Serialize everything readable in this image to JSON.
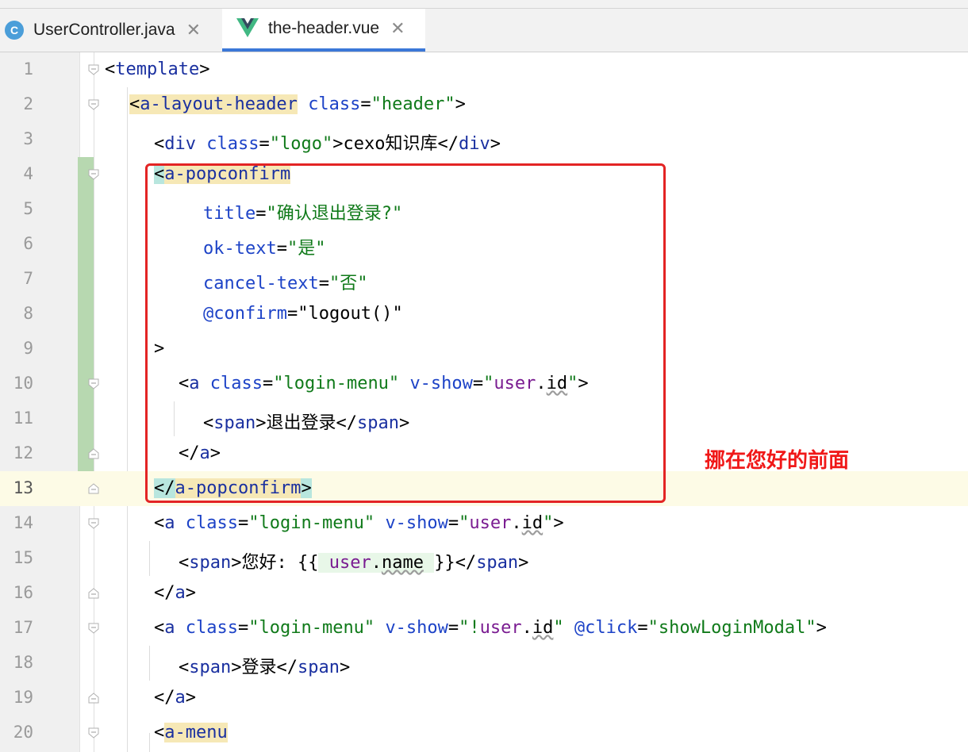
{
  "tabs": [
    {
      "icon": "java-class-icon",
      "icon_letter": "C",
      "label": "UserController.java",
      "active": false
    },
    {
      "icon": "vue-icon",
      "label": "the-header.vue",
      "active": true
    }
  ],
  "lines": [
    {
      "n": "1"
    },
    {
      "n": "2"
    },
    {
      "n": "3"
    },
    {
      "n": "4"
    },
    {
      "n": "5"
    },
    {
      "n": "6"
    },
    {
      "n": "7"
    },
    {
      "n": "8"
    },
    {
      "n": "9"
    },
    {
      "n": "10"
    },
    {
      "n": "11"
    },
    {
      "n": "12"
    },
    {
      "n": "13",
      "current": true
    },
    {
      "n": "14"
    },
    {
      "n": "15"
    },
    {
      "n": "16"
    },
    {
      "n": "17"
    },
    {
      "n": "18"
    },
    {
      "n": "19"
    },
    {
      "n": "20"
    }
  ],
  "code": {
    "l1": {
      "open": "<",
      "tag": "template",
      "close": ">"
    },
    "l2": {
      "lt": "<",
      "tag": "a-layout-header",
      "attr": "class",
      "eq": "=",
      "val": "\"header\"",
      "gt": ">"
    },
    "l3": {
      "lt": "<",
      "tag": "div",
      "attr": "class",
      "eq": "=",
      "val": "\"logo\"",
      "gt": ">",
      "text": "cexo知识库",
      "endlt": "</",
      "endtag": "div",
      "endgt": ">"
    },
    "l4": {
      "lt": "<",
      "tag": "a-popconfirm"
    },
    "l5": {
      "attr": "title",
      "eq": "=",
      "val": "\"确认退出登录?\""
    },
    "l6": {
      "attr": "ok-text",
      "eq": "=",
      "val": "\"是\""
    },
    "l7": {
      "attr": "cancel-text",
      "eq": "=",
      "val": "\"否\""
    },
    "l8": {
      "attr": "@confirm",
      "eq": "=",
      "val_open": "\"",
      "val_fn": "logout()",
      "val_close": "\""
    },
    "l9": {
      "gt": ">"
    },
    "l10": {
      "lt": "<",
      "tag": "a",
      "attr1": "class",
      "eq1": "=",
      "val1": "\"login-menu\"",
      "attr2": "v-show",
      "eq2": "=",
      "q_open": "\"",
      "var": "user",
      "dot": ".",
      "prop": "id",
      "q_close": "\"",
      "gt": ">"
    },
    "l11": {
      "lt": "<",
      "tag": "span",
      "gt": ">",
      "text": "退出登录",
      "endlt": "</",
      "endtag": "span",
      "endgt": ">"
    },
    "l12": {
      "lt": "</",
      "tag": "a",
      "gt": ">"
    },
    "l13": {
      "lt": "</",
      "tag": "a-popconfirm",
      "gt": ">"
    },
    "l14": {
      "lt": "<",
      "tag": "a",
      "attr1": "class",
      "eq1": "=",
      "val1": "\"login-menu\"",
      "attr2": "v-show",
      "eq2": "=",
      "q_open": "\"",
      "var": "user",
      "dot": ".",
      "prop": "id",
      "q_close": "\"",
      "gt": ">"
    },
    "l15": {
      "lt": "<",
      "tag": "span",
      "gt": ">",
      "text": "您好: {{",
      "var": "user",
      "dot": ".",
      "prop": "name",
      "text2": "}}",
      "endlt": "</",
      "endtag": "span",
      "endgt": ">"
    },
    "l16": {
      "lt": "</",
      "tag": "a",
      "gt": ">"
    },
    "l17": {
      "lt": "<",
      "tag": "a",
      "attr1": "class",
      "eq1": "=",
      "val1": "\"login-menu\"",
      "attr2": "v-show",
      "eq2": "=",
      "q_open": "\"!",
      "var": "user",
      "dot": ".",
      "prop": "id",
      "q_close": "\"",
      "attr3": "@click",
      "eq3": "=",
      "val3": "\"showLoginModal\"",
      "gt": ">"
    },
    "l18": {
      "lt": "<",
      "tag": "span",
      "gt": ">",
      "text": "登录",
      "endlt": "</",
      "endtag": "span",
      "endgt": ">"
    },
    "l19": {
      "lt": "</",
      "tag": "a",
      "gt": ">"
    },
    "l20": {
      "lt": "<",
      "tag": "a-menu"
    }
  },
  "annotation": "挪在您好的前面",
  "colors": {
    "highlight_box": "#e32424",
    "active_tab_underline": "#3b78d8",
    "change_bar": "#b7d8b0"
  }
}
